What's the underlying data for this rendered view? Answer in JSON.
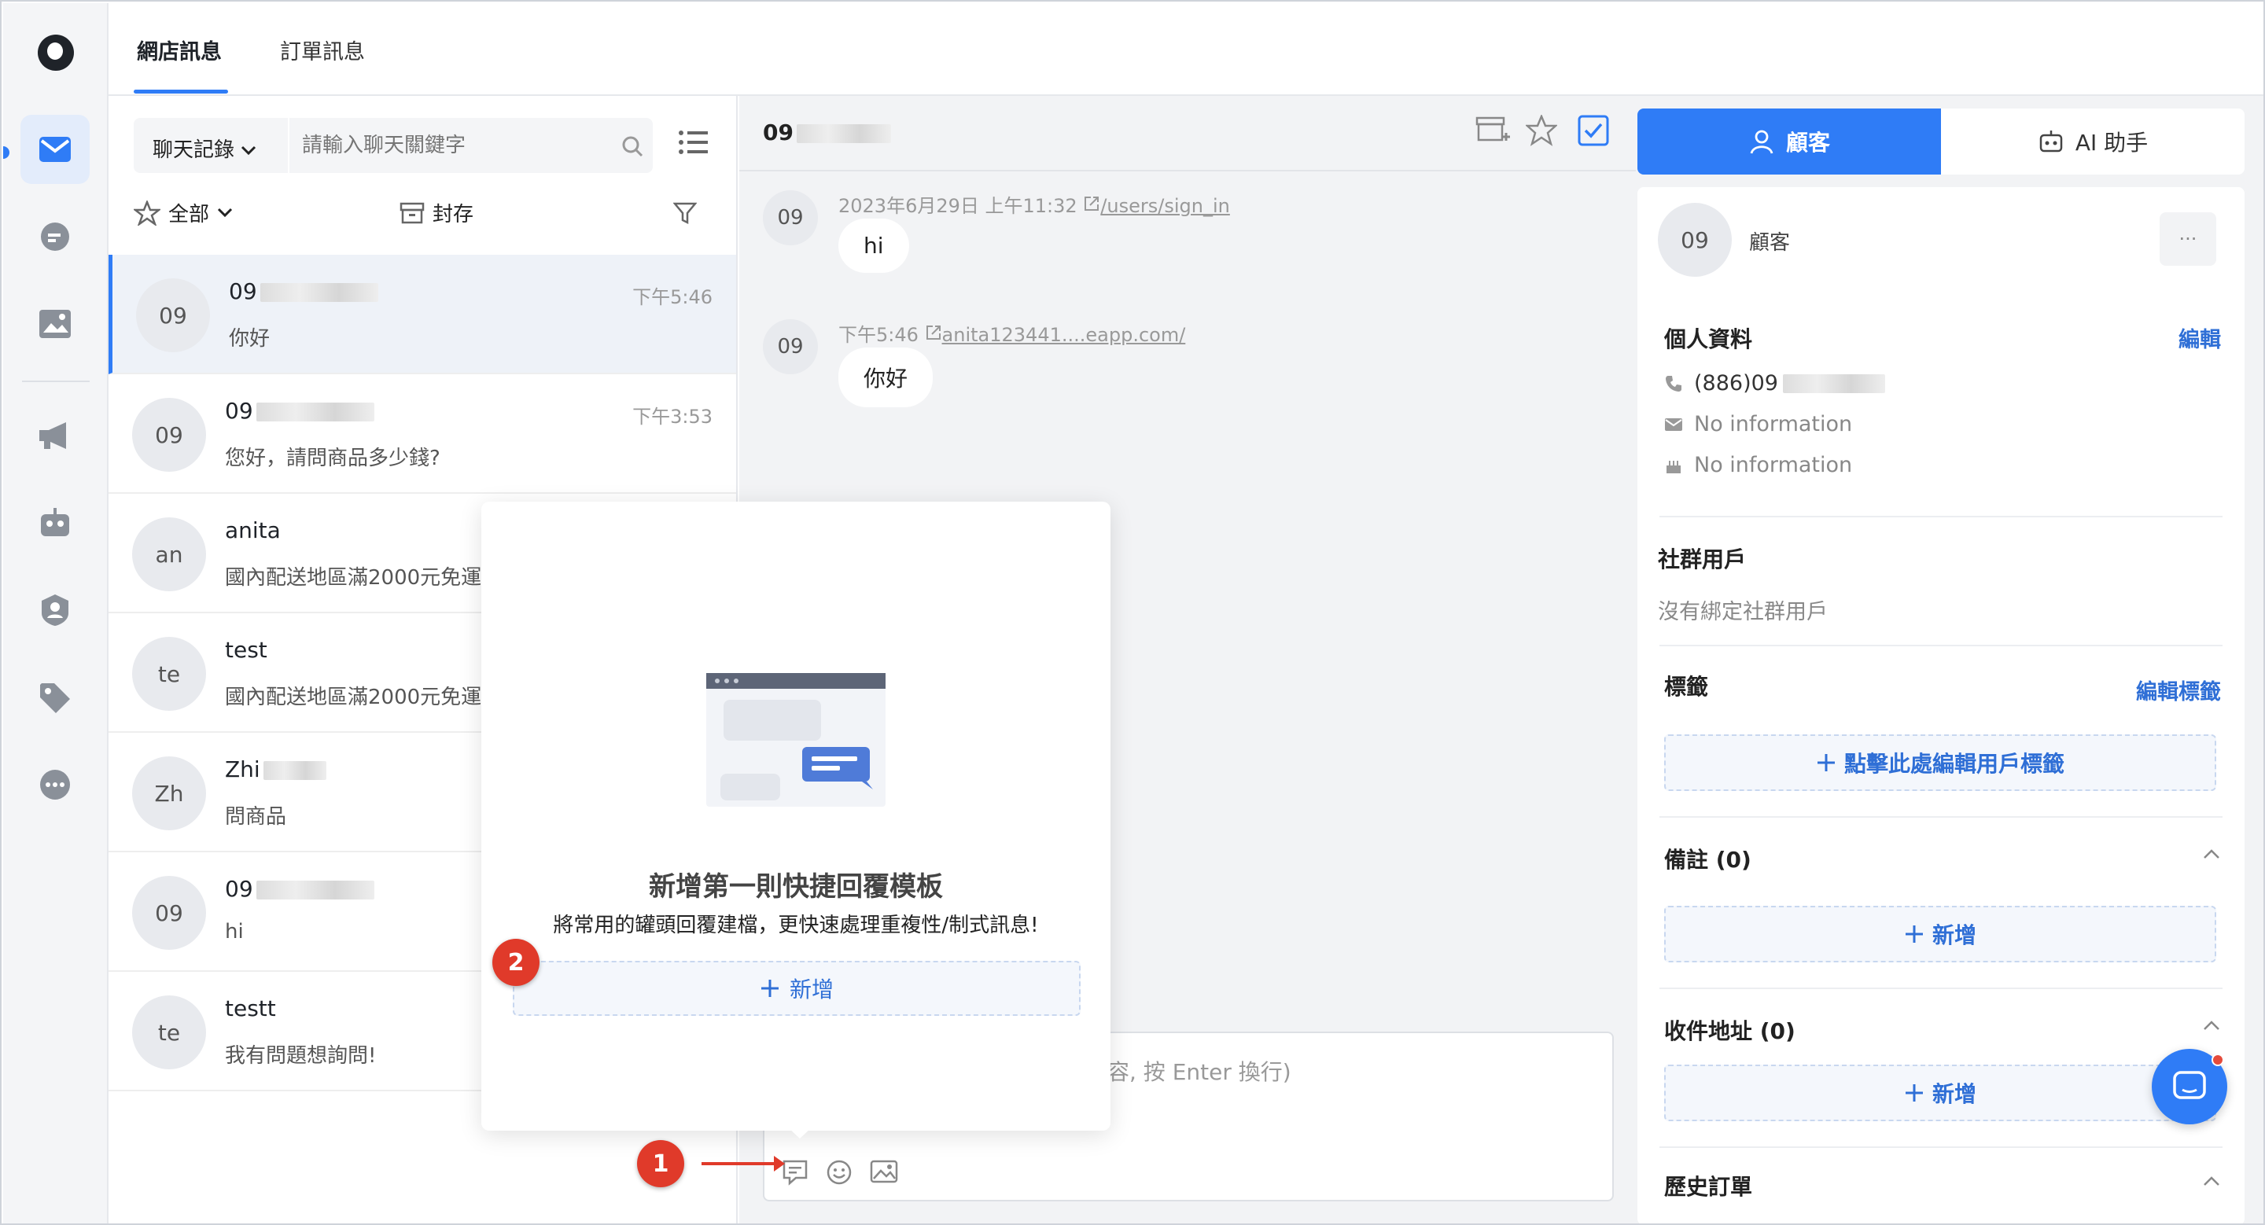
{
  "tabs": {
    "shop_messages": "網店訊息",
    "order_messages": "訂單訊息"
  },
  "list": {
    "filter_select": "聊天記錄",
    "search_placeholder": "請輸入聊天關鍵字",
    "filter_all": "全部",
    "archive": "封存",
    "conversations": [
      {
        "initials": "09",
        "name": "09",
        "time": "下午5:46",
        "message": "你好"
      },
      {
        "initials": "09",
        "name": "09",
        "time": "下午3:53",
        "message": "您好，請問商品多少錢?"
      },
      {
        "initials": "an",
        "name": "anita",
        "time": "",
        "message": "國內配送地區滿2000元免運"
      },
      {
        "initials": "te",
        "name": "test",
        "time": "",
        "message": "國內配送地區滿2000元免運"
      },
      {
        "initials": "Zh",
        "name": "Zhi",
        "time": "",
        "message": "問商品"
      },
      {
        "initials": "09",
        "name": "09",
        "time": "",
        "message": "hi"
      },
      {
        "initials": "te",
        "name": "testt",
        "time": "",
        "message": "我有問題想詢問!"
      }
    ]
  },
  "chat": {
    "title": "09",
    "messages": [
      {
        "initials": "09",
        "meta": "2023年6月29日 上午11:32",
        "link": "/users/sign_in",
        "text": "hi"
      },
      {
        "initials": "09",
        "meta": "下午5:46",
        "link": "anita123441....eapp.com/",
        "text": "你好"
      }
    ],
    "composer_placeholder": "容, 按 Enter 換行)"
  },
  "popup": {
    "title": "新增第一則快捷回覆模板",
    "description": "將常用的罐頭回覆建檔，更快速處理重複性/制式訊息!",
    "add_label": "新增"
  },
  "badges": {
    "one": "1",
    "two": "2"
  },
  "right": {
    "tab_customer": "顧客",
    "tab_ai": "AI 助手",
    "customer_initials": "09",
    "customer_label": "顧客",
    "more": "···",
    "profile_title": "個人資料",
    "edit": "編輯",
    "phone": "(886)09",
    "email": "No information",
    "birthday": "No information",
    "social_title": "社群用戶",
    "social_empty": "沒有綁定社群用戶",
    "tags_title": "標籤",
    "edit_tags": "編輯標籤",
    "add_tag": "點擊此處編輯用戶標籤",
    "notes_title": "備註 (0)",
    "notes_add": "新增",
    "address_title": "收件地址 (0)",
    "address_add": "新增",
    "history_title": "歷史訂單"
  },
  "colors": {
    "accent": "#2f7cf6",
    "badge": "#e03a2a"
  }
}
